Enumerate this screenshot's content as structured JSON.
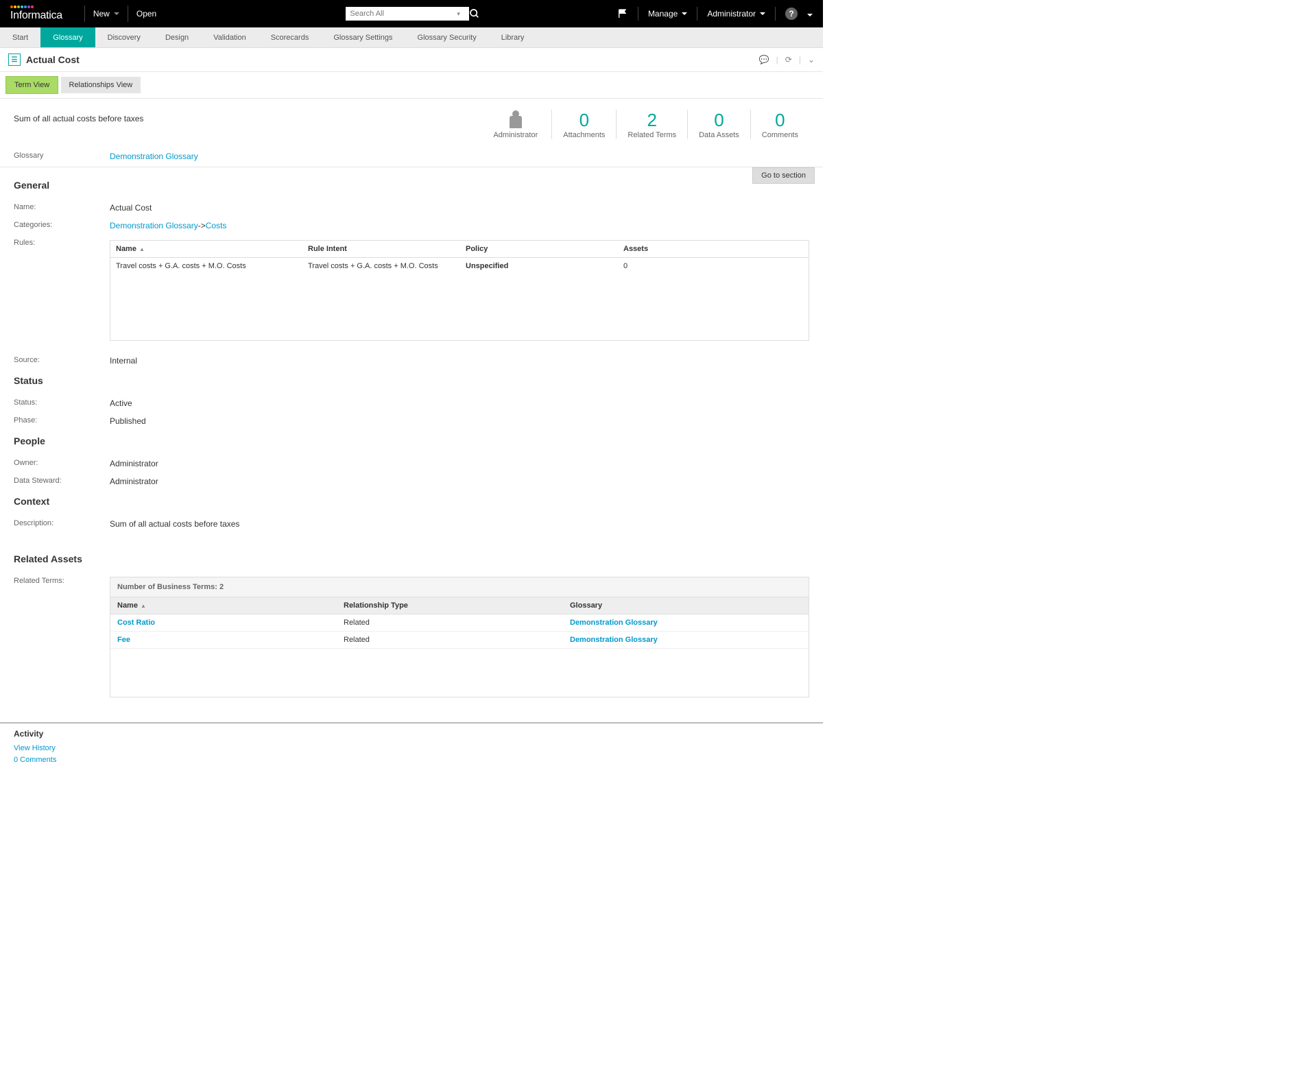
{
  "topbar": {
    "new_label": "New",
    "open_label": "Open",
    "search_placeholder": "Search All",
    "manage_label": "Manage",
    "admin_label": "Administrator"
  },
  "tabs": {
    "items": [
      "Start",
      "Glossary",
      "Discovery",
      "Design",
      "Validation",
      "Scorecards",
      "Glossary Settings",
      "Glossary Security",
      "Library"
    ],
    "active_index": 1
  },
  "page": {
    "title": "Actual Cost",
    "view_tabs": {
      "term": "Term View",
      "relationships": "Relationships View"
    },
    "description": "Sum of all actual costs before taxes",
    "glossary_label": "Glossary",
    "glossary_link": "Demonstration Glossary",
    "goto_section": "Go to section"
  },
  "stats": {
    "admin_label": "Administrator",
    "attachments": {
      "value": "0",
      "label": "Attachments"
    },
    "related_terms": {
      "value": "2",
      "label": "Related Terms"
    },
    "data_assets": {
      "value": "0",
      "label": "Data Assets"
    },
    "comments": {
      "value": "0",
      "label": "Comments"
    }
  },
  "sections": {
    "general": {
      "title": "General",
      "name_label": "Name:",
      "name_value": "Actual Cost",
      "categories_label": "Categories:",
      "categories_link1": "Demonstration Glossary",
      "categories_sep": "->",
      "categories_link2": "Costs",
      "rules_label": "Rules:",
      "rules_headers": {
        "name": "Name",
        "intent": "Rule Intent",
        "policy": "Policy",
        "assets": "Assets"
      },
      "rules_row": {
        "name": "Travel costs + G.A. costs + M.O. Costs",
        "intent": "Travel costs + G.A. costs + M.O. Costs",
        "policy": "Unspecified",
        "assets": "0"
      },
      "source_label": "Source:",
      "source_value": "Internal"
    },
    "status": {
      "title": "Status",
      "status_label": "Status:",
      "status_value": "Active",
      "phase_label": "Phase:",
      "phase_value": "Published"
    },
    "people": {
      "title": "People",
      "owner_label": "Owner:",
      "owner_value": "Administrator",
      "steward_label": "Data Steward:",
      "steward_value": "Administrator"
    },
    "context": {
      "title": "Context",
      "desc_label": "Description:",
      "desc_value": "Sum of all actual costs before taxes"
    },
    "related_assets": {
      "title": "Related Assets",
      "terms_label": "Related Terms:",
      "caption": "Number of Business Terms: 2",
      "headers": {
        "name": "Name",
        "type": "Relationship Type",
        "glossary": "Glossary"
      },
      "rows": [
        {
          "name": "Cost Ratio",
          "type": "Related",
          "glossary": "Demonstration Glossary"
        },
        {
          "name": "Fee",
          "type": "Related",
          "glossary": "Demonstration Glossary"
        }
      ]
    }
  },
  "activity": {
    "title": "Activity",
    "view_history": "View History",
    "comments": "0 Comments"
  }
}
